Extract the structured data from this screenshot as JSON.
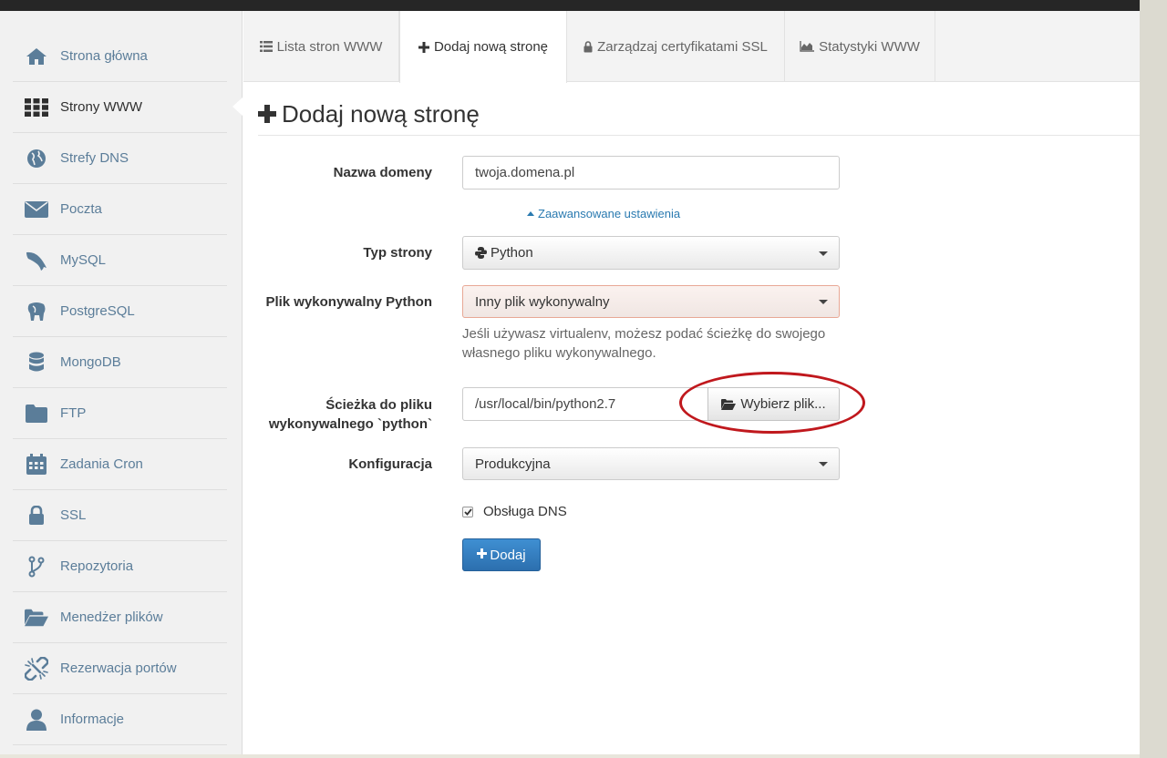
{
  "sidebar": {
    "items": [
      {
        "label": "Strona główna",
        "icon": "home-icon"
      },
      {
        "label": "Strony WWW",
        "icon": "grid-icon",
        "active": true
      },
      {
        "label": "Strefy DNS",
        "icon": "globe-icon"
      },
      {
        "label": "Poczta",
        "icon": "envelope-icon"
      },
      {
        "label": "MySQL",
        "icon": "dolphin-icon"
      },
      {
        "label": "PostgreSQL",
        "icon": "elephant-icon"
      },
      {
        "label": "MongoDB",
        "icon": "database-icon"
      },
      {
        "label": "FTP",
        "icon": "folder-icon"
      },
      {
        "label": "Zadania Cron",
        "icon": "calendar-icon"
      },
      {
        "label": "SSL",
        "icon": "lock-icon"
      },
      {
        "label": "Repozytoria",
        "icon": "branch-icon"
      },
      {
        "label": "Menedżer plików",
        "icon": "folder-open-icon"
      },
      {
        "label": "Rezerwacja portów",
        "icon": "plug-icon"
      },
      {
        "label": "Informacje",
        "icon": "user-icon"
      }
    ]
  },
  "tabs": [
    {
      "label": "Lista stron WWW",
      "icon": "list-icon"
    },
    {
      "label": "Dodaj nową stronę",
      "icon": "plus-icon",
      "active": true
    },
    {
      "label": "Zarządzaj certyfikatami SSL",
      "icon": "lock-icon"
    },
    {
      "label": "Statystyki WWW",
      "icon": "area-chart-icon"
    }
  ],
  "page": {
    "title": "Dodaj nową stronę",
    "title_icon": "plus-icon"
  },
  "form": {
    "domain_label": "Nazwa domeny",
    "domain_value": "twoja.domena.pl",
    "advanced_link": "Zaawansowane ustawienia",
    "type_label": "Typ strony",
    "type_value": "Python",
    "python_exec_label": "Plik wykonywalny Python",
    "python_exec_value": "Inny plik wykonywalny",
    "help_text": "Jeśli używasz virtualenv, możesz podać ścieżkę do swojego własnego pliku wykonywalnego.",
    "path_label_line1": "Ścieżka do pliku",
    "path_label_line2": "wykonywalnego `python`",
    "path_value": "/usr/local/bin/python2.7",
    "browse_button": "Wybierz plik...",
    "config_label": "Konfiguracja",
    "config_value": "Produkcyjna",
    "dns_checkbox_label": "Obsługa DNS",
    "dns_checked": true,
    "submit_button": "Dodaj"
  },
  "colors": {
    "accent": "#2c6fae",
    "sidebar_text": "#5b7d99",
    "highlight_oval": "#c0181d",
    "error_border": "#e8a895"
  }
}
